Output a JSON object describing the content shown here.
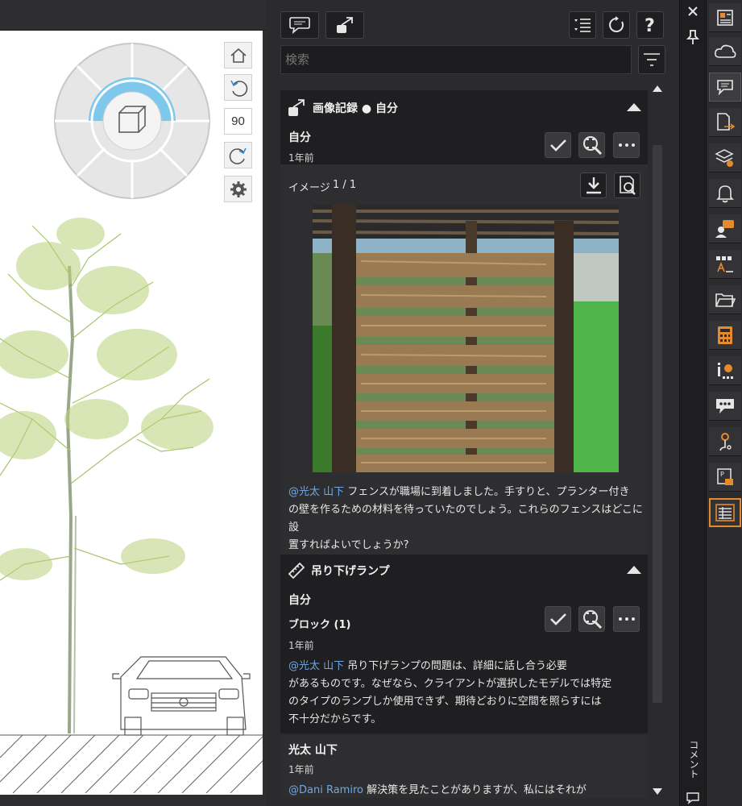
{
  "drawing": {
    "zoom_value": "90"
  },
  "toolbar": {
    "search_placeholder": "検索"
  },
  "markup": {
    "title": "画像記録 ● 自分",
    "author": "自分",
    "time": "1年前",
    "image_label": "イメージ",
    "image_index": "1 / 1",
    "mention": "@光太 山下",
    "comment_lines": [
      " フェンスが職場に到着しました。手すりと、プランター付き",
      "の壁を作るための材料を待っていたのでしょう。これらのフェンスはどこに設",
      "置すればよいでしょうか?"
    ]
  },
  "issue": {
    "title": "吊り下げランプ",
    "author": "自分",
    "block": "ブロック (1)",
    "time": "1年前",
    "mention": "@光太 山下",
    "comment_lines": [
      "  吊り下げランプの問題は、詳細に話し合う必要",
      "があるものです。なぜなら、クライアントが選択したモデルでは特定",
      "のタイプのランプしか使用できず、期待どおりに空間を照らすには",
      "不十分だからです。"
    ]
  },
  "reply": {
    "author": "光太 山下",
    "time": "1年前",
    "mention": "@Dani Ramiro",
    "comment_line": "  解決策を見たことがありますが、私にはそれが"
  },
  "side_label": "コメント",
  "colors": {
    "accent_orange": "#e68a2e",
    "mention_blue": "#6da9e8",
    "viewcube_blue": "#7ec8ee",
    "tree_green": "#a8c46a"
  }
}
